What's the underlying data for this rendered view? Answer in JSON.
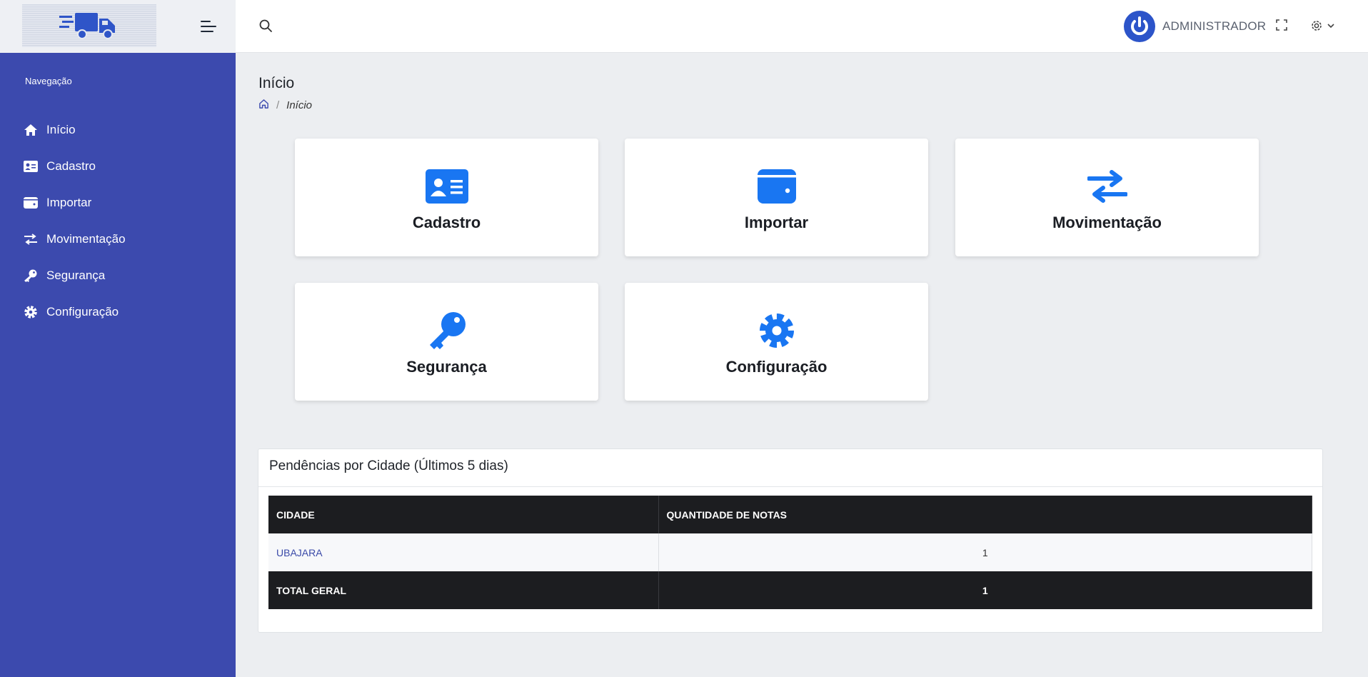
{
  "header": {
    "user_name": "ADMINISTRADOR"
  },
  "sidebar": {
    "caption": "Navegação",
    "items": [
      {
        "label": "Início",
        "icon": "home-icon"
      },
      {
        "label": "Cadastro",
        "icon": "id-card-icon"
      },
      {
        "label": "Importar",
        "icon": "wallet-icon"
      },
      {
        "label": "Movimentação",
        "icon": "exchange-icon"
      },
      {
        "label": "Segurança",
        "icon": "key-icon"
      },
      {
        "label": "Configuração",
        "icon": "gear-icon"
      }
    ]
  },
  "page": {
    "title": "Início",
    "breadcrumb_current": "Início"
  },
  "cards": [
    {
      "label": "Cadastro",
      "icon": "id-card-icon"
    },
    {
      "label": "Importar",
      "icon": "wallet-icon"
    },
    {
      "label": "Movimentação",
      "icon": "exchange-icon"
    },
    {
      "label": "Segurança",
      "icon": "key-icon"
    },
    {
      "label": "Configuração",
      "icon": "gear-icon"
    }
  ],
  "pendencias": {
    "title": "Pendências por Cidade (Últimos 5 dias)",
    "columns": [
      "CIDADE",
      "QUANTIDADE DE NOTAS"
    ],
    "rows": [
      {
        "cidade": "UBAJARA",
        "quantidade": "1"
      }
    ],
    "total_label": "TOTAL GERAL",
    "total_value": "1"
  },
  "colors": {
    "sidebar": "#3c4aae",
    "accent_icon": "#1976f2",
    "avatar": "#2c54c9",
    "table_dark": "#1c1d20"
  }
}
